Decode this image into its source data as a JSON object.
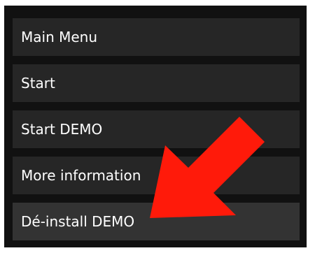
{
  "menu": {
    "items": [
      {
        "label": "Main Menu"
      },
      {
        "label": "Start"
      },
      {
        "label": "Start DEMO"
      },
      {
        "label": "More information"
      },
      {
        "label": "Dé-install DEMO"
      }
    ]
  },
  "annotation": {
    "arrow_icon": "arrow-pointer-icon",
    "arrow_color": "#ff1a0a"
  },
  "colors": {
    "panel_background": "#111111",
    "item_background": "#262626",
    "text": "#ffffff"
  }
}
